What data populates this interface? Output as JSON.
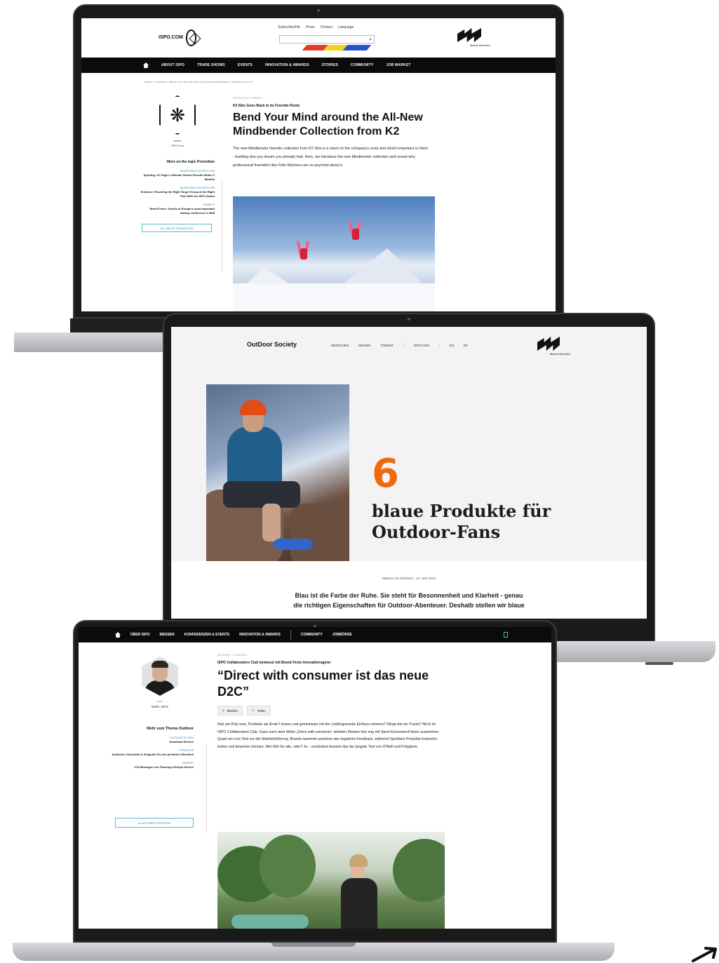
{
  "laptop_ispo": {
    "util_links": [
      "Subscribe/Info",
      "Press",
      "Contact",
      "Language"
    ],
    "logo_text": "ISPO.COM",
    "brand_caption": "Messe München",
    "nav": [
      "ABOUT ISPO",
      "TRADE SHOWS",
      "EVENTS",
      "INNOVATION & AWARDS",
      "STORIES",
      "COMMUNITY",
      "JOB MARKET"
    ],
    "breadcrumb": "Home > Products > Bend Your Mind around the All-New Mindbender Collection from K2",
    "author_role": "Author",
    "author_name": "ISPO.com",
    "more_heading": "More on the topic Promotion",
    "side_links": [
      {
        "cat": "ADVERTISING ON ISPO.COM",
        "ttl": "Sporting: K2 Page's Ultimate Search Results Within 3 Months"
      },
      {
        "cat": "ADVERTISING ON ISPO.COM",
        "ttl": "Entrance: Reaching the Right Target Group at the Right Time With the ISPO Award"
      },
      {
        "cat": "SUMMITS",
        "ttl": "Brand Pulse: Guests to Europe's most important startup conference in Bali"
      }
    ],
    "side_button": "ALL ABOUT PROMOTION",
    "kicker": "PRODUCTS & TRENDS",
    "subline": "K2 Skis Goes Back to its Freeride Roots",
    "title": "Bend Your Mind around the All-New Mindbender Collection from K2",
    "lede": "The new Mindbender freeride collection from K2 Skis is a return to the company's roots and what's important to them - building skis you dream you already had. Here, we introduce the new Mindbender collection and reveal why professional freeriders like Felix Wiemers are so psyched about it."
  },
  "laptop_ods": {
    "brand": "OutDoor Society",
    "nav": [
      "MENSCHEN",
      "WISSEN",
      "TRENDS",
      "ISPO.COM",
      "EN",
      "DE"
    ],
    "brand_caption": "Messe München",
    "number": "6",
    "title": "blaue Produkte für Outdoor-Fans",
    "meta": "Martina von Ilmebach  ·  16. April 2023",
    "lede": "Blau ist die Farbe der Ruhe. Sie steht für Besonnenheit und Klarheit - genau die richtigen Eigenschaften für Outdoor-Abenteuer. Deshalb stellen wir blaue"
  },
  "laptop_direct": {
    "nav": [
      "ÜBER ISPO",
      "MESSEN",
      "KONFERENZEN & EVENTS",
      "INNOVATION & AWARDS",
      "COMMUNITY",
      "JOBBÖRSE"
    ],
    "author_role": "Autor",
    "author_name": "Martin Jahns",
    "more_heading": "Mehr zum Thema Outdoor",
    "side_links": [
      {
        "cat": "OUTDOOR BY ISPO",
        "ttl": "Download Service"
      },
      {
        "cat": "PRODUKTE",
        "ttl": "Ausleihen Checkliste & Zeitgeber für den perfekten Überblick"
      },
      {
        "cat": "MENSCH",
        "ttl": "6 Erzählungen von Pausing-Lifestyle-Stories"
      }
    ],
    "side_button": "ALLES ÜBER OUTDOOR",
    "kicker": "BUSINESS · 13.04.2023",
    "subline": "ISPO Collaborators Club bewiesst mit Brand-Tests Innovationsgeist",
    "title": "“Direct with consumer ist das neue D2C”",
    "actions": [
      "Merken",
      "Teilen"
    ],
    "body": "Nah am Puls sein, Produkte als Erste*r testen und gemeinsam mit der Lieblingsmarke Einfluss nehmen? Klingt wie ein Traum? Nicht im ISPO Collaborators Club. Ganz nach dem Motto „Direct with consumer“ arbeiten Marken hier eng mit Sport-Konsument*innen zusammen. Quasi ein Live-Test vor der Markteinführung. Brands sammeln positives wie negatives Feedback, während Sportfans Produkte kostenlos testen und bewerten können. Win-Win für alle, oder? Ja – zumindest beweist das der jüngste Test von O'Neill und Polygiene."
  },
  "icons": [
    "home-icon",
    "search-icon",
    "bookmark-icon",
    "share-icon",
    "expand-arrow-icon"
  ],
  "colors": {
    "accent_orange": "#ef6a0b",
    "link_teal": "#1a8fb0",
    "nav_black": "#0b0b0b"
  }
}
